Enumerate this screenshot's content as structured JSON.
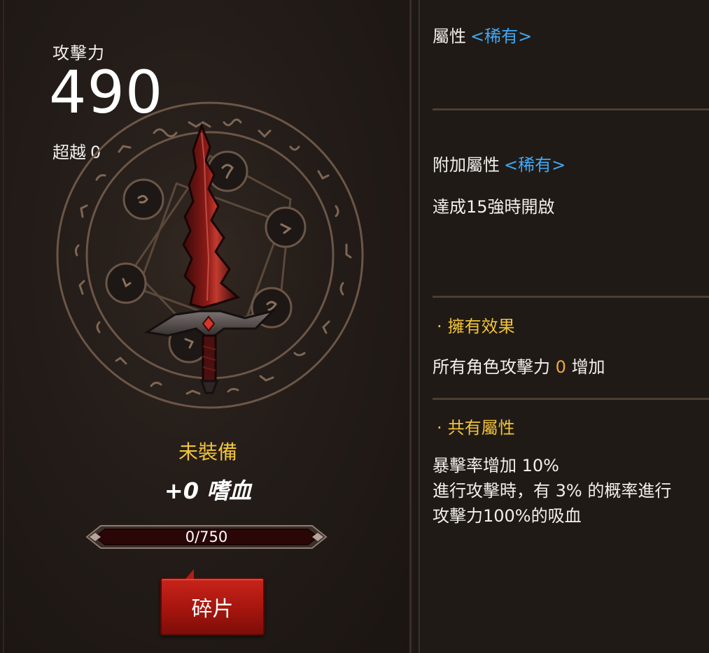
{
  "stats": {
    "attack_label": "攻擊力",
    "attack_value": "490",
    "transcend_label": "超越",
    "transcend_value": "0"
  },
  "weapon": {
    "equip_status": "未裝備",
    "name": "+0 嗜血",
    "fragment_progress": "0/750",
    "fragment_progress_fraction": 0,
    "fragment_button": "碎片"
  },
  "details": {
    "attribute_label": "屬性",
    "attribute_rarity": "<稀有>",
    "extra_attribute_label": "附加屬性",
    "extra_attribute_rarity": "<稀有>",
    "extra_attribute_unlock": "達成15強時開啟",
    "possession_effect_title": "擁有效果",
    "possession_effect_prefix": "所有角色攻擊力",
    "possession_effect_value": "0",
    "possession_effect_suffix": "增加",
    "shared_attribute_title": "共有屬性",
    "shared_attribute_lines": [
      "暴擊率增加 10%",
      "進行攻擊時，有 3% 的概率進行",
      "攻擊力100%的吸血"
    ]
  },
  "colors": {
    "rarity": "#3fa9f5",
    "gold": "#f0c43a",
    "button_red": "#b61c13"
  },
  "icons": {
    "magic_circle": "magic-circle-emblem",
    "weapon": "bloodthirst-sword"
  }
}
